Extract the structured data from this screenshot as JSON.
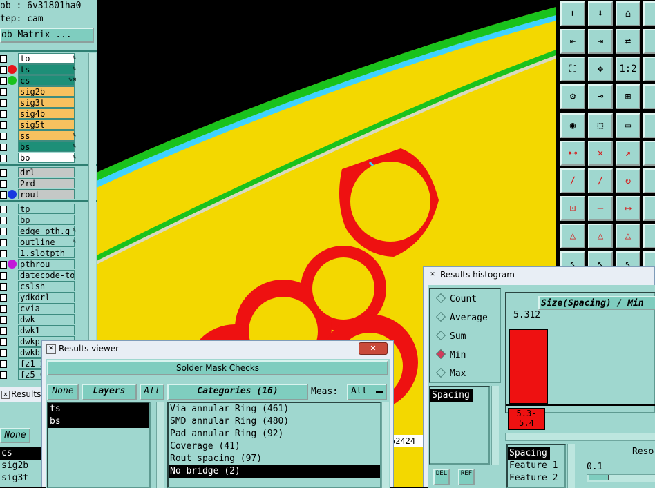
{
  "left_panel": {
    "job_line": "ob : 6v31801ha0",
    "step_line": "tep: cam",
    "job_matrix_button": "ob Matrix ...",
    "layers_group1": [
      {
        "name": "to",
        "style": "white",
        "dot": "",
        "mark": "✎"
      },
      {
        "name": "ts",
        "style": "teal",
        "dot": "#e8141a",
        "mark": "✎"
      },
      {
        "name": "cs",
        "style": "teal",
        "dot": "#19c21c",
        "mark": "✎⊠"
      },
      {
        "name": "sig2b",
        "style": "orange",
        "dot": "",
        "mark": ""
      },
      {
        "name": "sig3t",
        "style": "orange",
        "dot": "",
        "mark": ""
      },
      {
        "name": "sig4b",
        "style": "orange",
        "dot": "",
        "mark": ""
      },
      {
        "name": "sig5t",
        "style": "orange",
        "dot": "",
        "mark": ""
      },
      {
        "name": "ss",
        "style": "orange",
        "dot": "",
        "mark": "✎"
      },
      {
        "name": "bs",
        "style": "teal",
        "dot": "",
        "mark": "✎"
      },
      {
        "name": "bo",
        "style": "white",
        "dot": "",
        "mark": "✎"
      }
    ],
    "layers_group2": [
      {
        "name": "drl",
        "style": "gray",
        "dot": "",
        "mark": ""
      },
      {
        "name": "2rd",
        "style": "gray",
        "dot": "",
        "mark": ""
      },
      {
        "name": "rout",
        "style": "gray",
        "dot": "#1638e0",
        "mark": ""
      }
    ],
    "layers_group3": [
      {
        "name": "tp",
        "style": "mint",
        "dot": "",
        "mark": ""
      },
      {
        "name": "bp",
        "style": "mint",
        "dot": "",
        "mark": ""
      },
      {
        "name": "edge_pth.g",
        "style": "mint",
        "dot": "",
        "mark": "✎"
      },
      {
        "name": "outline",
        "style": "mint",
        "dot": "",
        "mark": "✎"
      },
      {
        "name": "1.slotpth",
        "style": "mint",
        "dot": "",
        "mark": ""
      },
      {
        "name": "pthrou",
        "style": "mint",
        "dot": "#c21ad9",
        "mark": ""
      },
      {
        "name": "datecode-to",
        "style": "mint",
        "dot": "",
        "mark": ""
      },
      {
        "name": "cslsh",
        "style": "mint",
        "dot": "",
        "mark": ""
      },
      {
        "name": "ydkdrl",
        "style": "mint",
        "dot": "",
        "mark": ""
      },
      {
        "name": "cvia",
        "style": "mint",
        "dot": "",
        "mark": ""
      },
      {
        "name": "dwk",
        "style": "mint",
        "dot": "",
        "mark": ""
      },
      {
        "name": "dwk1",
        "style": "mint",
        "dot": "",
        "mark": ""
      },
      {
        "name": "dwkp",
        "style": "mint",
        "dot": "",
        "mark": ""
      },
      {
        "name": "dwkb",
        "style": "mint",
        "dot": "",
        "mark": ""
      },
      {
        "name": "fz1-2",
        "style": "mint",
        "dot": "",
        "mark": ""
      },
      {
        "name": "fz5-6",
        "style": "mint",
        "dot": "",
        "mark": ""
      }
    ],
    "results_tab": "Results",
    "none_button": "None",
    "bottom_layers": [
      "cs",
      "sig2b",
      "sig3t"
    ]
  },
  "status_value": "52424",
  "results_viewer": {
    "title": "Results viewer",
    "close": "✕",
    "header": "Solder Mask Checks",
    "none_button": "None",
    "layers_button": "Layers",
    "all_button": "All",
    "categories_button": "Categories (16)",
    "meas_label": "Meas:",
    "meas_value": "All",
    "layers": [
      "ts",
      "bs"
    ],
    "categories": [
      "Via annular Ring (461)",
      "SMD annular Ring (480)",
      "Pad annular Ring (92)",
      "Coverage (41)",
      "Rout spacing (97)",
      "No bridge (2)"
    ],
    "selected_category_index": 5
  },
  "histogram": {
    "title": "Results histogram",
    "options": [
      "Count",
      "Average",
      "Sum",
      "Min",
      "Max"
    ],
    "selected_option": "Min",
    "list_item": "Spacing",
    "del_button": "DEL",
    "ref_button": "REF",
    "axis_title": "Size(Spacing) / Min",
    "bar_value": "5.312",
    "bar_range": "5.3-\n5.4",
    "bar_fill": 0.88,
    "bottom_list": [
      "Spacing",
      "Feature 1",
      "Feature 2"
    ],
    "reso_label": "Reso",
    "reso_value": "0.1"
  },
  "colors": {
    "panel": "#9fd7cf",
    "button": "#7fcdbf",
    "board_yellow": "#f3d800",
    "copper_red": "#ee1111",
    "trace_green": "#19c21c",
    "trace_cyan": "#3fd2ff"
  },
  "tool_icons": [
    "layer-up-icon",
    "layer-down-icon",
    "home-icon",
    "",
    "move-icon",
    "move-right-icon",
    "swap-icon",
    "",
    "fit-icon",
    "zoom-icon",
    "ratio-icon",
    "",
    "tool-icon",
    "measure-icon",
    "net-icon",
    "",
    "snap-icon",
    "select-icon",
    "ruler-icon",
    "",
    "connect-icon",
    "cross-icon",
    "point-icon",
    "",
    "line-icon",
    "line2-icon",
    "rotate-icon",
    "",
    "feature-icon",
    "line-edit-icon",
    "dim-icon",
    "",
    "triangle-icon",
    "triangle2-icon",
    "triangle3-icon",
    "",
    "cursor-icon",
    "cursor2-icon",
    "cursor3-icon",
    ""
  ]
}
